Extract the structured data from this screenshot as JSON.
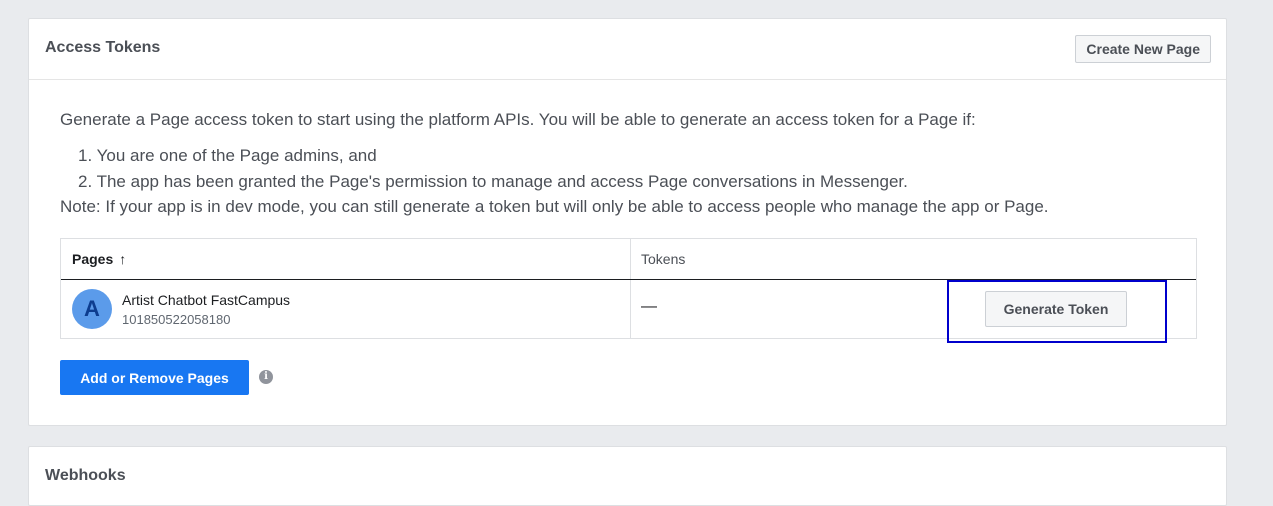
{
  "access_tokens": {
    "title": "Access Tokens",
    "create_page_label": "Create New Page",
    "intro": "Generate a Page access token to start using the platform APIs. You will be able to generate an access token for a Page if:",
    "conditions": [
      "1. You are one of the Page admins, and",
      "2. The app has been granted the Page's permission to manage and access Page conversations in Messenger."
    ],
    "note": "Note: If your app is in dev mode, you can still generate a token but will only be able to access people who manage the app or Page.",
    "table": {
      "col_pages": "Pages",
      "sort_icon": "arrow-up-icon",
      "col_tokens": "Tokens",
      "rows": [
        {
          "avatar_letter": "A",
          "name": "Artist Chatbot FastCampus",
          "id": "101850522058180",
          "token": "—",
          "action_label": "Generate Token"
        }
      ]
    },
    "add_remove_label": "Add or Remove Pages",
    "info_icon": "info-icon"
  },
  "webhooks": {
    "title": "Webhooks"
  },
  "colors": {
    "primary": "#1877f2",
    "highlight": "#0000cc",
    "background": "#e9ebee"
  }
}
